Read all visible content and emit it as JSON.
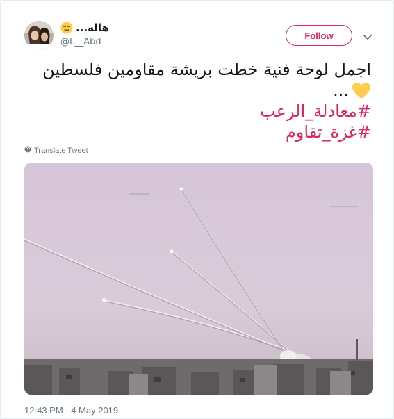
{
  "author": {
    "name": "...هاله",
    "handle": "@L__Abd"
  },
  "actions": {
    "follow_label": "Follow"
  },
  "tweet": {
    "line1": "اجمل لوحة فنية خطت بريشة مقاومين فلسطين",
    "line2": "...",
    "hashtag1": "#معادلة_الرعب",
    "hashtag2": "#غزة_تقاوم"
  },
  "translate_label": "Translate Tweet",
  "timestamp": "12:43 PM - 4 May 2019",
  "colors": {
    "accent": "#e0245e",
    "secondary_text": "#657786",
    "heart": "#ffcc4d"
  },
  "icons": [
    "expressionless-face-emoji",
    "yellow-heart-emoji",
    "globe-icon",
    "chevron-down-icon"
  ]
}
